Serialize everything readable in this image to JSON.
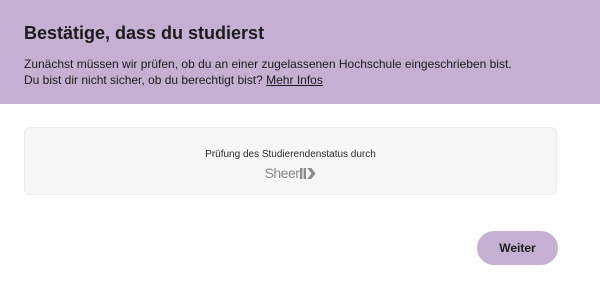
{
  "header": {
    "title": "Bestätige, dass du studierst",
    "line1": "Zunächst müssen wir prüfen, ob du an einer zugelassenen Hochschule eingeschrieben bist.",
    "line2_prefix": "Du bist dir nicht sicher, ob du berechtigt bist?",
    "info_link": "Mehr Infos"
  },
  "verification": {
    "label": "Prüfung des Studierendenstatus durch",
    "provider_text": "Sheer",
    "provider_mark": "ID"
  },
  "actions": {
    "next_label": "Weiter"
  },
  "colors": {
    "accent": "#c5b0d4",
    "card_background": "#f7f7f7",
    "text": "#1b1b1b",
    "logo": "#8a8a8a"
  }
}
